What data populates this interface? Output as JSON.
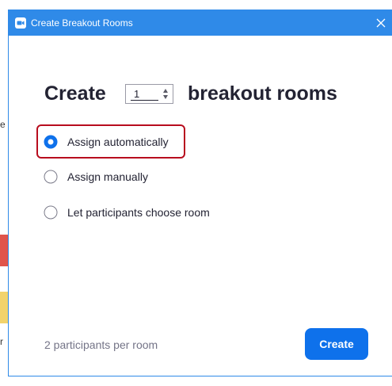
{
  "window": {
    "title": "Create Breakout Rooms",
    "accent_color": "#2f8ae8",
    "close_icon": "close-icon"
  },
  "heading": {
    "prefix": "Create",
    "rooms_count": "1",
    "suffix": "breakout rooms"
  },
  "options": [
    {
      "label": "Assign automatically",
      "selected": true
    },
    {
      "label": "Assign manually",
      "selected": false
    },
    {
      "label": "Let participants choose room",
      "selected": false
    }
  ],
  "footer": {
    "summary": "2 participants per room",
    "create_label": "Create",
    "button_color": "#0e71eb"
  },
  "annotation": {
    "highlight_color": "#b80d1e"
  },
  "background": {
    "left_fragments": [
      "e",
      "r"
    ]
  }
}
